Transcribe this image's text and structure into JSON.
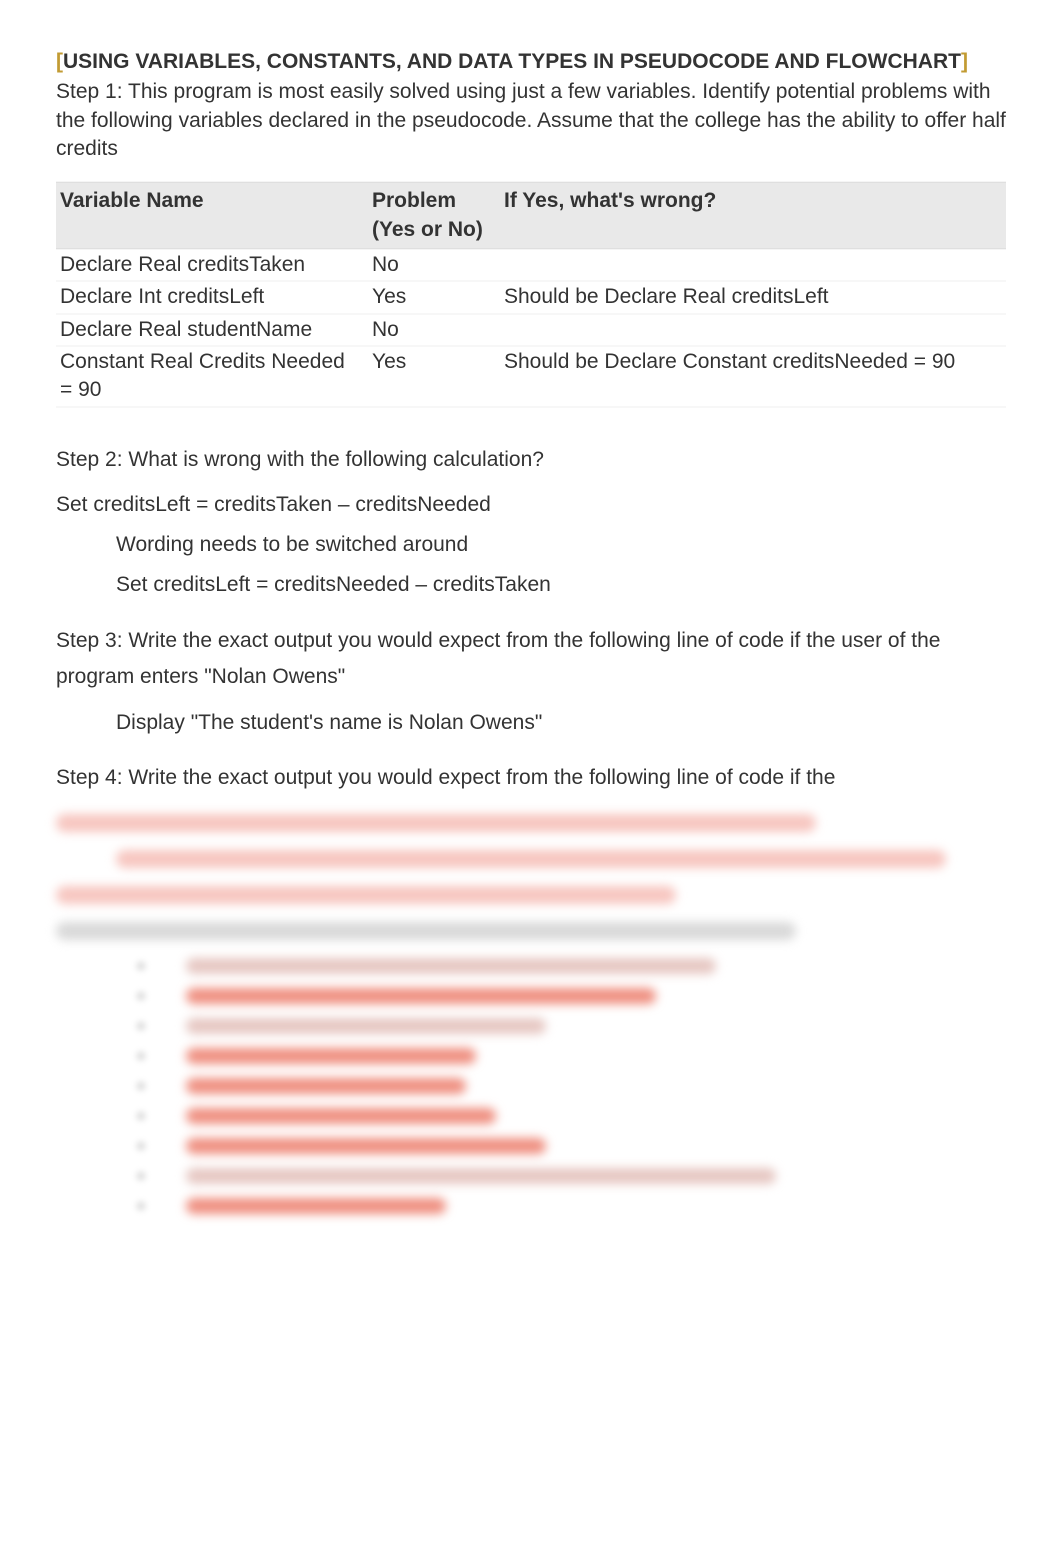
{
  "title": {
    "bracket_open": "[",
    "text": "USING VARIABLES, CONSTANTS, AND DATA TYPES IN PSEUDOCODE AND FLOWCHART",
    "bracket_close": "]"
  },
  "intro": "Step 1: This program is most easily solved using just a few variables. Identify potential problems with the following variables declared in the pseudocode. Assume that the college has the ability to offer half credits",
  "table": {
    "headers": {
      "name": "Variable Name",
      "problem": "Problem (Yes or No)",
      "wrong": "If Yes, what's wrong?"
    },
    "rows": [
      {
        "name": "Declare Real creditsTaken",
        "problem": "No",
        "wrong": ""
      },
      {
        "name": "Declare Int creditsLeft",
        "problem": "Yes",
        "wrong": "Should be Declare Real creditsLeft"
      },
      {
        "name": "Declare Real studentName",
        "problem": "No",
        "wrong": ""
      },
      {
        "name": "Constant Real Credits Needed = 90",
        "problem": "Yes",
        "wrong": "Should be  Declare Constant creditsNeeded = 90"
      }
    ]
  },
  "step2": {
    "q": "Step 2: What is wrong with the following calculation?",
    "expr": "Set creditsLeft = creditsTaken – creditsNeeded",
    "ans1": "Wording needs to be switched around",
    "ans2": "Set creditsLeft = creditsNeeded – creditsTaken"
  },
  "step3": {
    "q": "Step 3: Write the exact output you would expect from the following line of code if the user of the program enters \"Nolan Owens\"",
    "ans": "Display \"The student's name is Nolan Owens\""
  },
  "step4": {
    "q": "Step 4: Write the exact output you would expect from the following line of code if the"
  }
}
